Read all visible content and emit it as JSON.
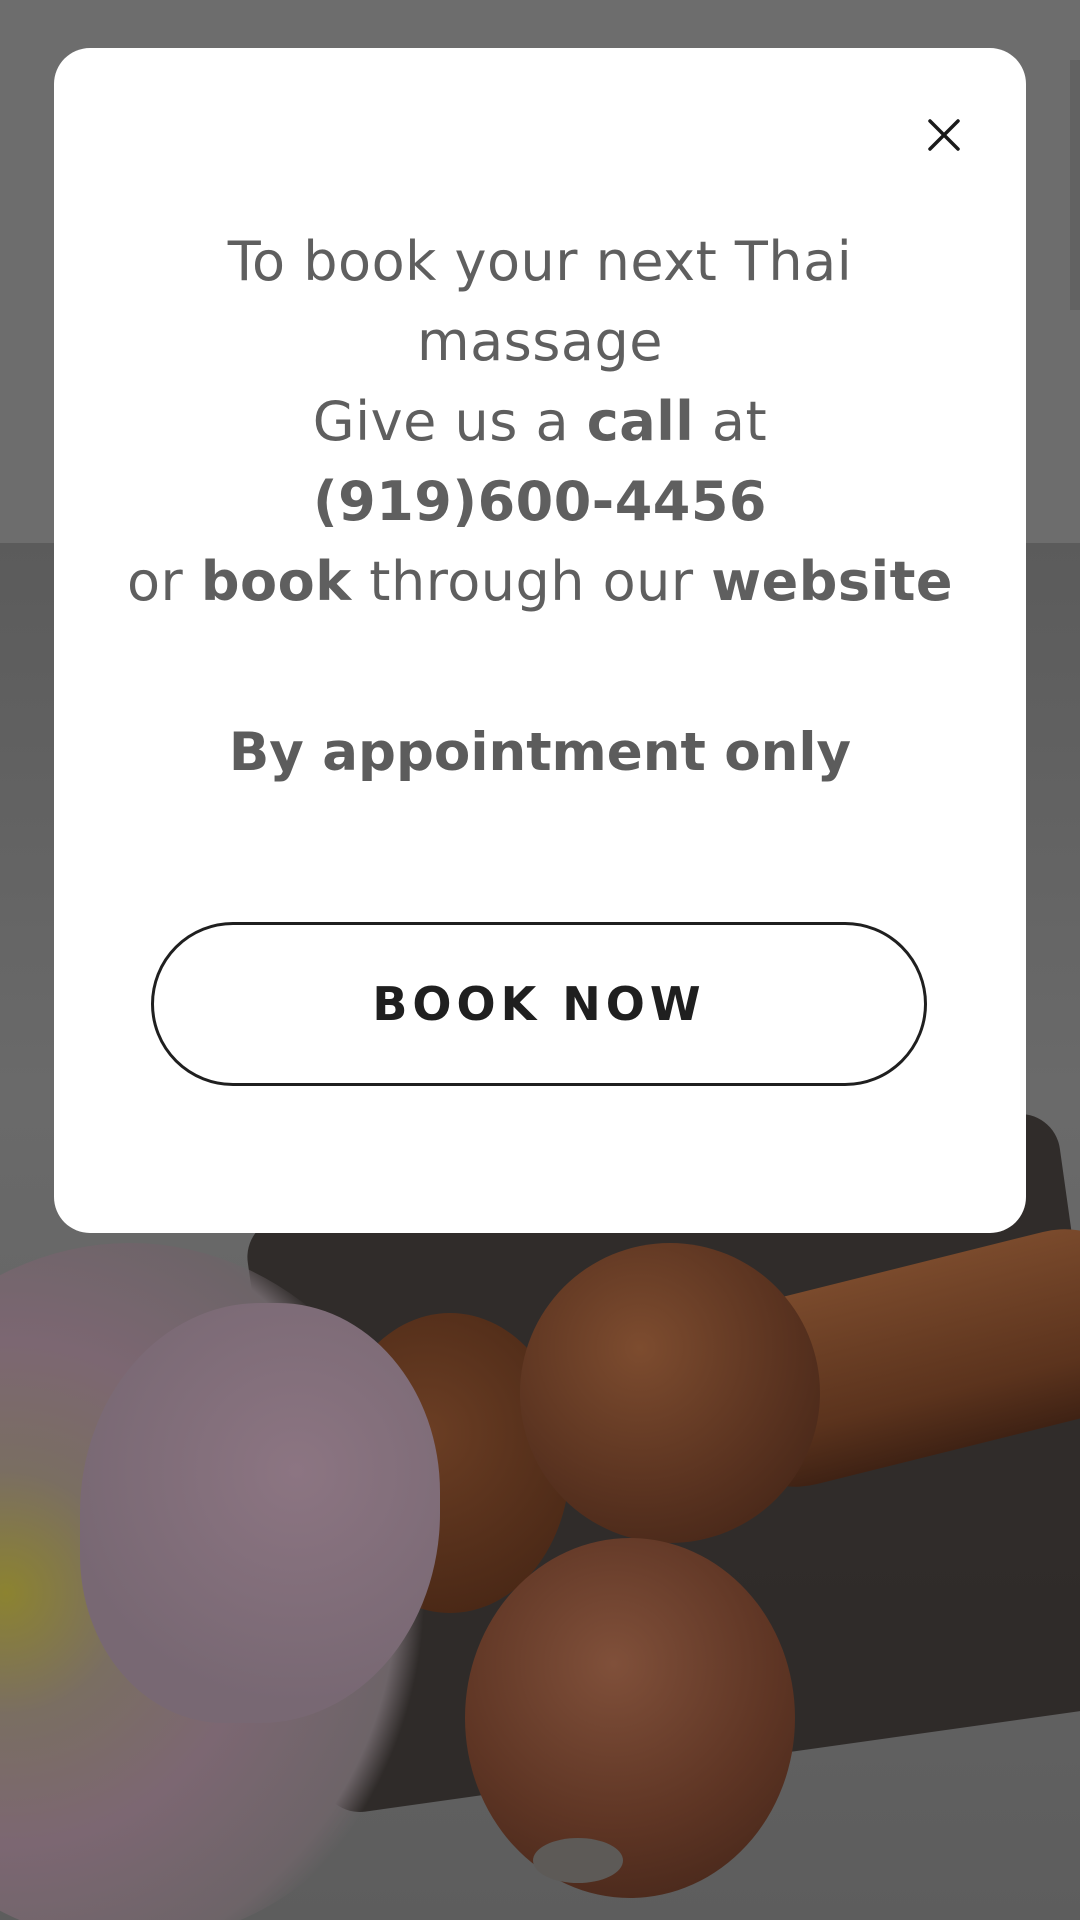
{
  "modal": {
    "close_icon": "close-icon",
    "message": {
      "line1": "To book your next Thai massage",
      "line2_prefix": "Give us a ",
      "line2_call": "call",
      "line2_mid": " at ",
      "line2_phone": "(919)600-4456",
      "line3_prefix": "or ",
      "line3_book": "book",
      "line3_mid": " through our ",
      "line3_website": "website"
    },
    "appointment_note": "By appointment only",
    "book_button_label": "BOOK NOW"
  },
  "colors": {
    "overlay": "#6e6e6e",
    "modal_bg": "#ffffff",
    "text": "#5f5f5f",
    "button_border": "#1f1f1f"
  }
}
